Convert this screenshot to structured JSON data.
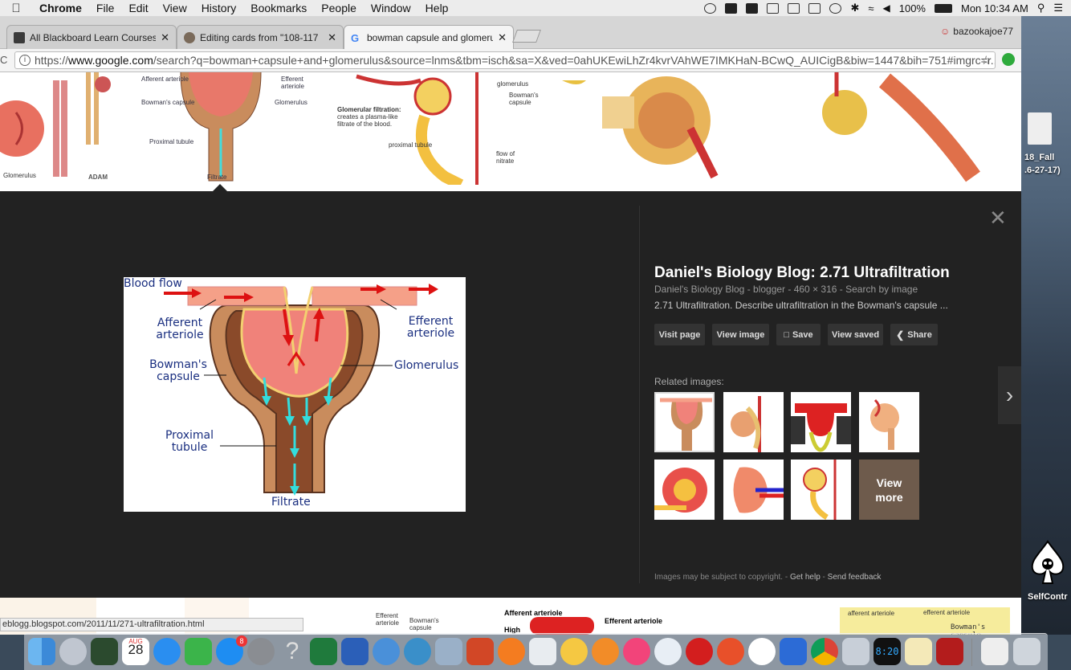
{
  "menubar": {
    "app": "Chrome",
    "items": [
      "File",
      "Edit",
      "View",
      "History",
      "Bookmarks",
      "People",
      "Window",
      "Help"
    ],
    "battery": "100%",
    "clock": "Mon 10:34 AM"
  },
  "tabs": [
    {
      "label": "All Blackboard Learn Courses -",
      "fav_color": "#3a3a3a"
    },
    {
      "label": "Editing cards from \"108-117",
      "fav_color": "#7a6a5a"
    },
    {
      "label": "bowman capsule and glomerul",
      "fav_color": "#ffffff"
    }
  ],
  "profile": "bazookajoe77",
  "address": {
    "scheme": "https://",
    "host": "www.google.com",
    "path": "/search?q=bowman+capsule+and+glomerulus&source=lnms&tbm=isch&sa=X&ved=0ahUKEwiLhZr4kvrVAhWE7IMKHaN-BCwQ_AUICigB&biw=1447&bih=751#imgrc=r..."
  },
  "strip": {
    "captions": {
      "adam_glomerulus": "Glomerulus",
      "adam_brand": "ADAM",
      "afferent": "Afferent arteriole",
      "efferent": "Efferent arteriole",
      "bowmans": "Bowman's capsule",
      "glomerulus": "Glomerulus",
      "proximal": "Proximal tubule",
      "filtrate": "Filtrate",
      "filtration_head": "Glomerular filtration:",
      "filtration_body": "creates a plasma-like filtrate of the blood.",
      "g3_glomerulus": "glomerulus",
      "g3_bowmans": "Bowman's capsule",
      "g3_proximal": "proximal tubule",
      "g3_flow": "flow of nitrate"
    }
  },
  "panel": {
    "title": "Daniel's Biology Blog: 2.71 Ultrafiltration",
    "meta": "Daniel's Biology Blog - blogger - 460 × 316 - Search by image",
    "description": "2.71 Ultrafiltration. Describe ultrafiltration in the Bowman's capsule ...",
    "buttons": {
      "visit": "Visit page",
      "view": "View image",
      "save": "Save",
      "saved": "View saved",
      "share": "Share"
    },
    "related_title": "Related images:",
    "view_more": "View more",
    "footer": {
      "copyright": "Images may be subject to copyright.",
      "help": "Get help",
      "feedback": "Send feedback"
    }
  },
  "diagram": {
    "blood_flow": "Blood flow",
    "afferent": "Afferent arteriole",
    "efferent": "Efferent arteriole",
    "bowmans": "Bowman's capsule",
    "glomerulus": "Glomerulus",
    "proximal": "Proximal tubule",
    "filtrate": "Filtrate"
  },
  "statusbar": {
    "url": "eblogg.blogspot.com/2011/11/271-ultrafiltration.html"
  },
  "bottom": {
    "afferent": "Afferent arteriole",
    "efferent": "Efferent arteriole",
    "bowmans": "Bowman's capsule",
    "high": "High",
    "efferent2": "efferent arteriole",
    "afferent2": "afferent arteriole",
    "efferent_short": "Efferent arteriole"
  },
  "desktop": {
    "fall": "18_Fall",
    "fall_sub": ".6-27-17)",
    "selfcontrol": "SelfContr"
  },
  "dock": {
    "calendar_month": "AUG",
    "calendar_day": "28",
    "appstore_badge": "8",
    "clock_text": "8:20"
  }
}
